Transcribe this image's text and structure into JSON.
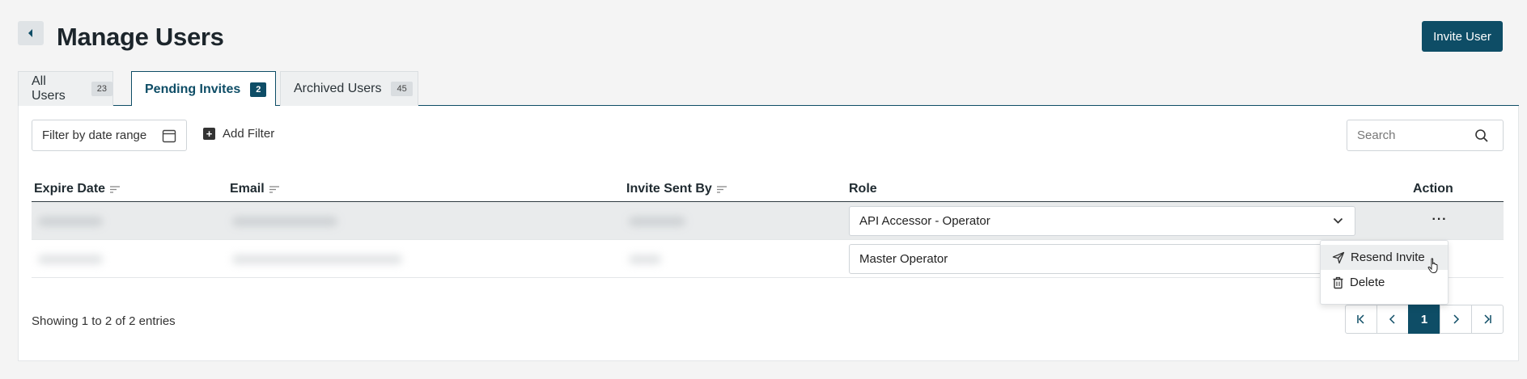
{
  "header": {
    "back_icon": "caret-left-icon",
    "title": "Manage Users",
    "invite_button": "Invite User"
  },
  "tabs": [
    {
      "label": "All Users",
      "count": "23",
      "active": false
    },
    {
      "label": "Pending Invites",
      "count": "2",
      "active": true
    },
    {
      "label": "Archived Users",
      "count": "45",
      "active": false
    }
  ],
  "filters": {
    "date_range_label": "Filter by date range",
    "date_icon": "calendar-icon",
    "add_filter_label": "Add Filter",
    "add_filter_icon": "plus-square-icon",
    "search_placeholder": "Search",
    "search_icon": "search-icon"
  },
  "table": {
    "columns": [
      "Expire Date",
      "Email",
      "Invite Sent By",
      "Role",
      "Action"
    ],
    "rows": [
      {
        "expire_date": "",
        "email": "",
        "invite_sent_by": "",
        "role": "API Accessor - Operator",
        "blurred": true
      },
      {
        "expire_date": "",
        "email": "",
        "invite_sent_by": "",
        "role": "Master Operator",
        "blurred": true
      }
    ],
    "action_label": "···"
  },
  "action_menu": {
    "items": [
      {
        "label": "Resend Invite",
        "icon": "send-icon"
      },
      {
        "label": "Delete",
        "icon": "trash-icon"
      }
    ]
  },
  "footer": {
    "showing_prefix": "Showing",
    "from": "1",
    "to_word": "to",
    "to": "2",
    "of_word": "of",
    "total": "2",
    "suffix": "entries"
  },
  "pagination": {
    "current_page": "1",
    "icons": [
      "first-page-icon",
      "prev-page-icon",
      "next-page-icon",
      "last-page-icon"
    ]
  },
  "colors": {
    "accent": "#0e4d66",
    "background": "#f4f4f4",
    "row_highlight": "#e9ebec"
  }
}
